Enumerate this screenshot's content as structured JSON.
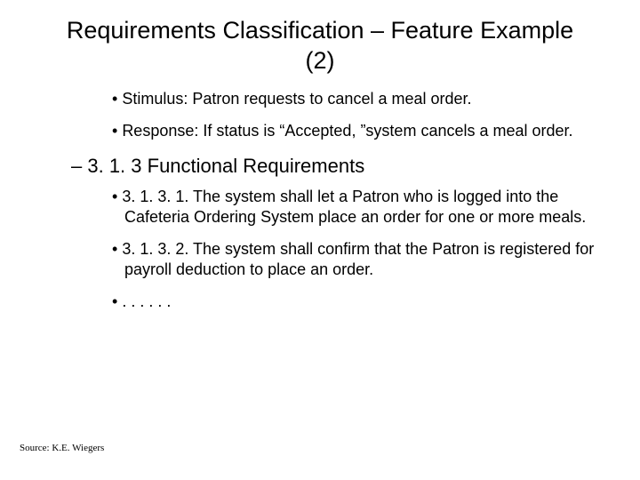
{
  "title": "Requirements Classification – Feature Example (2)",
  "bullets_top": [
    "Stimulus: Patron requests to cancel a meal order.",
    "Response: If status is “Accepted, ”system cancels a meal order."
  ],
  "section_heading": "3. 1. 3 Functional Requirements",
  "bullets_bottom": [
    "3. 1. 3. 1. The system shall let a Patron who is logged into the Cafeteria Ordering System place an order for one or more meals.",
    "3. 1. 3. 2. The system shall confirm that the Patron is registered for payroll deduction to place an order.",
    ". . . . . ."
  ],
  "source": "Source: K.E. Wiegers"
}
